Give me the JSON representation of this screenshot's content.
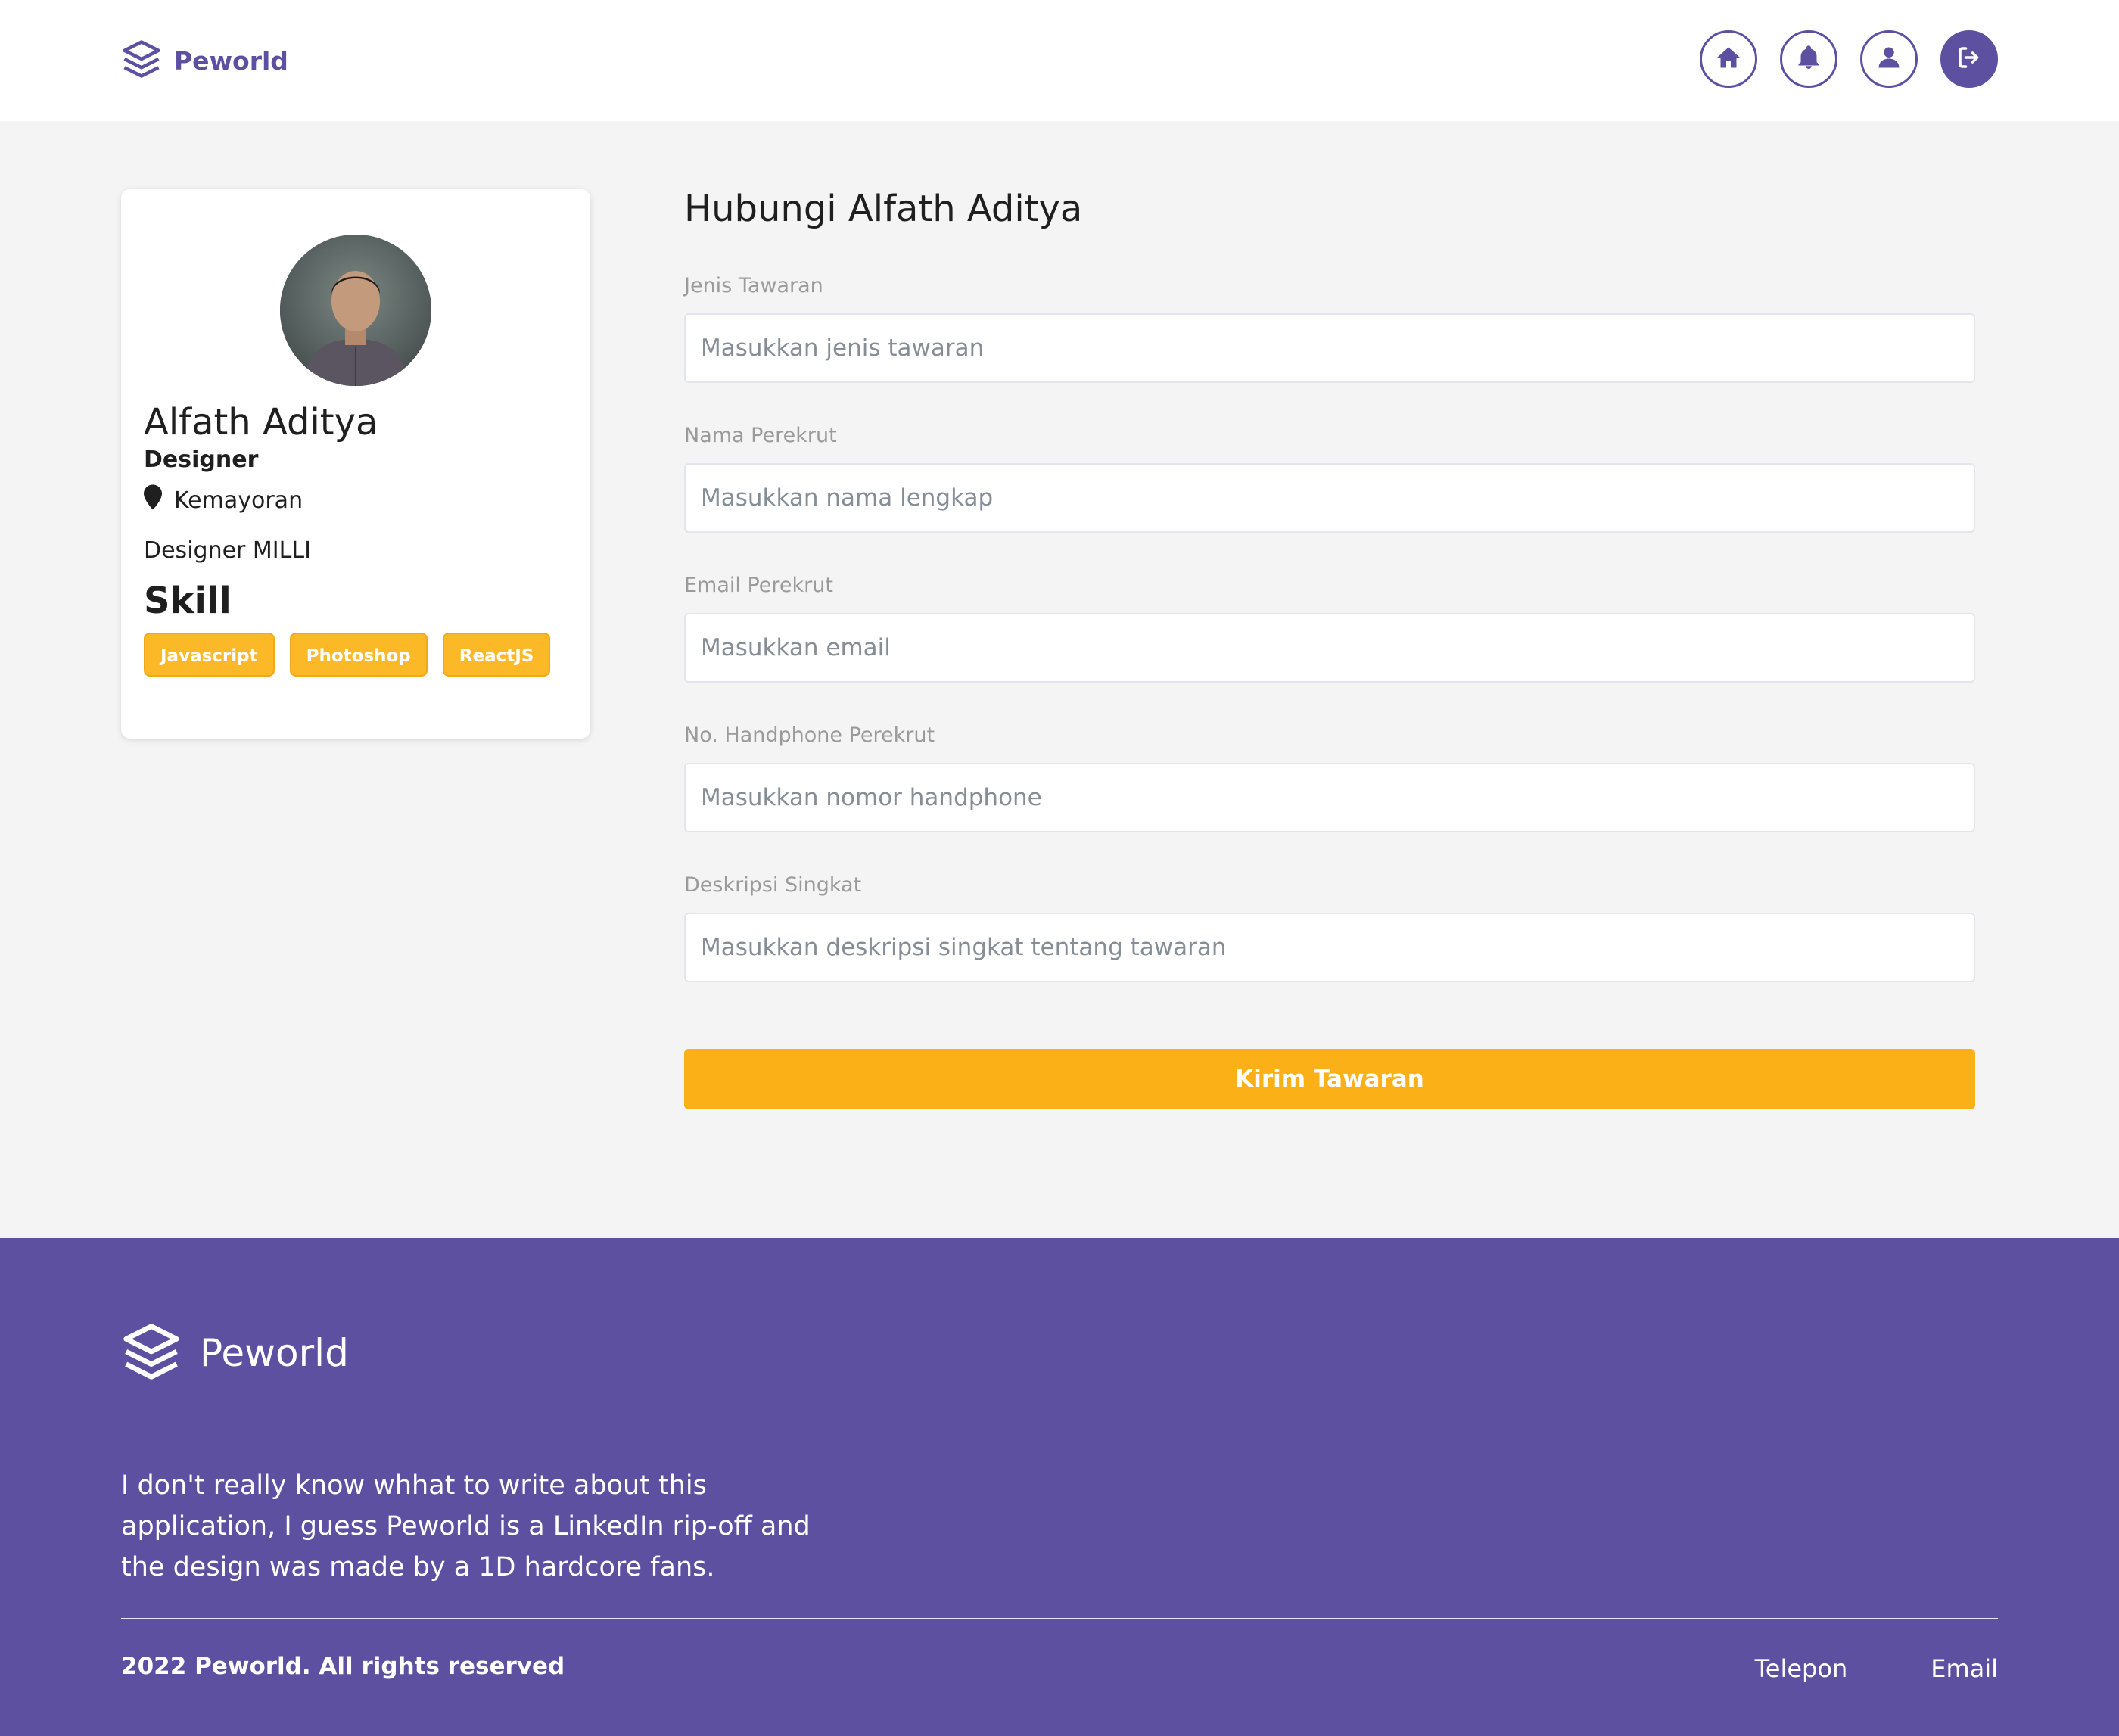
{
  "navbar": {
    "brand": "Peworld",
    "icons": [
      "home-icon",
      "bell-icon",
      "user-icon",
      "logout-icon"
    ]
  },
  "profile": {
    "name": "Alfath Aditya",
    "role": "Designer",
    "location": "Kemayoran",
    "description": "Designer MILLI",
    "skill_title": "Skill",
    "skills": [
      "Javascript",
      "Photoshop",
      "ReactJS"
    ]
  },
  "form": {
    "title": "Hubungi Alfath Aditya",
    "fields": [
      {
        "label": "Jenis Tawaran",
        "placeholder": "Masukkan jenis tawaran",
        "value": ""
      },
      {
        "label": "Nama Perekrut",
        "placeholder": "Masukkan nama lengkap",
        "value": ""
      },
      {
        "label": "Email Perekrut",
        "placeholder": "Masukkan email",
        "value": ""
      },
      {
        "label": "No. Handphone Perekrut",
        "placeholder": "Masukkan nomor handphone",
        "value": ""
      },
      {
        "label": "Deskripsi Singkat",
        "placeholder": "Masukkan deskripsi singkat tentang tawaran",
        "value": ""
      }
    ],
    "submit_label": "Kirim Tawaran"
  },
  "footer": {
    "brand": "Peworld",
    "about": "I don't really know whhat to write about this application, I guess Peworld is a LinkedIn rip-off and the design was made by a 1D hardcore fans.",
    "copyright": "2022 Peworld. All rights reserved",
    "links": [
      "Telepon",
      "Email"
    ]
  },
  "colors": {
    "primary": "#5e50a1",
    "accent": "#fbb017",
    "skill_badge": "#fbb927",
    "background": "#f4f4f4"
  }
}
